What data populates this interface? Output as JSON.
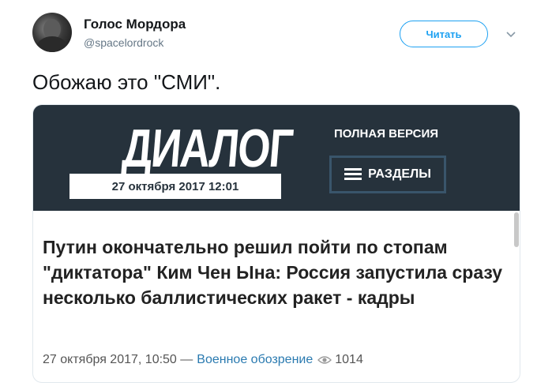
{
  "tweet": {
    "author_name": "Голос Мордора",
    "author_handle": "@spacelordrock",
    "follow_label": "Читать",
    "text": "Обожаю это \"СМИ\"."
  },
  "screenshot": {
    "logo": "ДИАЛОГ",
    "logo_date": "27 октября 2017 12:01",
    "full_version_label": "ПОЛНАЯ ВЕРСИЯ",
    "sections_label": "РАЗДЕЛЫ",
    "article_title": "Путин окончательно решил пойти по стопам \"диктатора\" Ким Чен Ына: Россия запустила сразу несколько баллистических ракет - кадры",
    "article_date": "27 октября 2017, 10:50 —",
    "article_source": "Военное обозрение",
    "views": "1014"
  },
  "colors": {
    "accent": "#1da1f2",
    "header_bg": "#26323c",
    "link": "#2a7ab0"
  }
}
